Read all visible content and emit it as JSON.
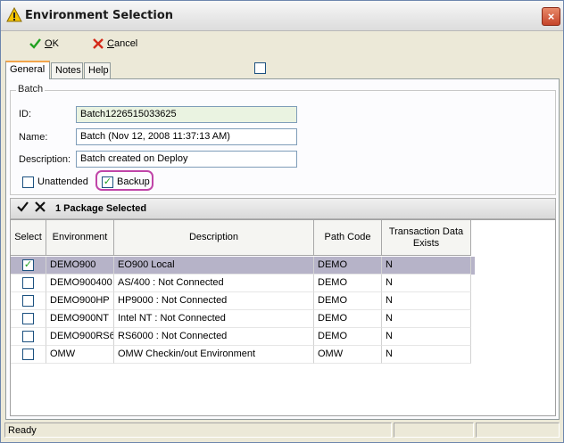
{
  "window": {
    "title": "Environment Selection",
    "close_icon": "×"
  },
  "toolbar": {
    "ok_label": "OK",
    "ok_mnemonic": "O",
    "cancel_label": "Cancel",
    "cancel_mnemonic": "C"
  },
  "tabs": [
    {
      "label": "General",
      "active": true
    },
    {
      "label": "Notes",
      "active": false
    },
    {
      "label": "Help",
      "active": false
    }
  ],
  "batch": {
    "group_title": "Batch",
    "id_label": "ID:",
    "id_value": "Batch1226515033625",
    "name_label": "Name:",
    "name_value": "Batch (Nov 12, 2008 11:37:13 AM)",
    "description_label": "Description:",
    "description_value": "Batch created on Deploy",
    "unattended_label": "Unattended",
    "unattended_checked": false,
    "backup_label": "Backup",
    "backup_checked": true
  },
  "selection_strip": {
    "text": "1 Package Selected"
  },
  "grid": {
    "columns": [
      "Select",
      "Environment",
      "Description",
      "Path Code",
      "Transaction Data Exists"
    ],
    "rows": [
      {
        "selected": true,
        "environment": "DEMO900",
        "description": "EO900 Local",
        "path_code": "DEMO",
        "data_exists": "N"
      },
      {
        "selected": false,
        "environment": "DEMO900400",
        "description": "AS/400  : Not Connected",
        "path_code": "DEMO",
        "data_exists": "N"
      },
      {
        "selected": false,
        "environment": "DEMO900HP",
        "description": "HP9000 : Not Connected",
        "path_code": "DEMO",
        "data_exists": "N"
      },
      {
        "selected": false,
        "environment": "DEMO900NT",
        "description": "Intel NT  : Not Connected",
        "path_code": "DEMO",
        "data_exists": "N"
      },
      {
        "selected": false,
        "environment": "DEMO900RS6",
        "description": "RS6000 : Not Connected",
        "path_code": "DEMO",
        "data_exists": "N"
      },
      {
        "selected": false,
        "environment": "OMW",
        "description": "OMW Checkin/out Environment",
        "path_code": "OMW",
        "data_exists": "N"
      }
    ]
  },
  "statusbar": {
    "text": "Ready"
  },
  "icons": {
    "title": "warning-triangle-icon",
    "ok": "check-icon",
    "cancel": "x-icon",
    "select_all": "check-icon",
    "deselect_all": "x-icon"
  },
  "colors": {
    "selected_row": "#b6b3c8",
    "readonly_field": "#eaf3e1",
    "backup_highlight": "#c045a8",
    "ok_green": "#21a121",
    "cancel_red": "#d42a1a"
  }
}
